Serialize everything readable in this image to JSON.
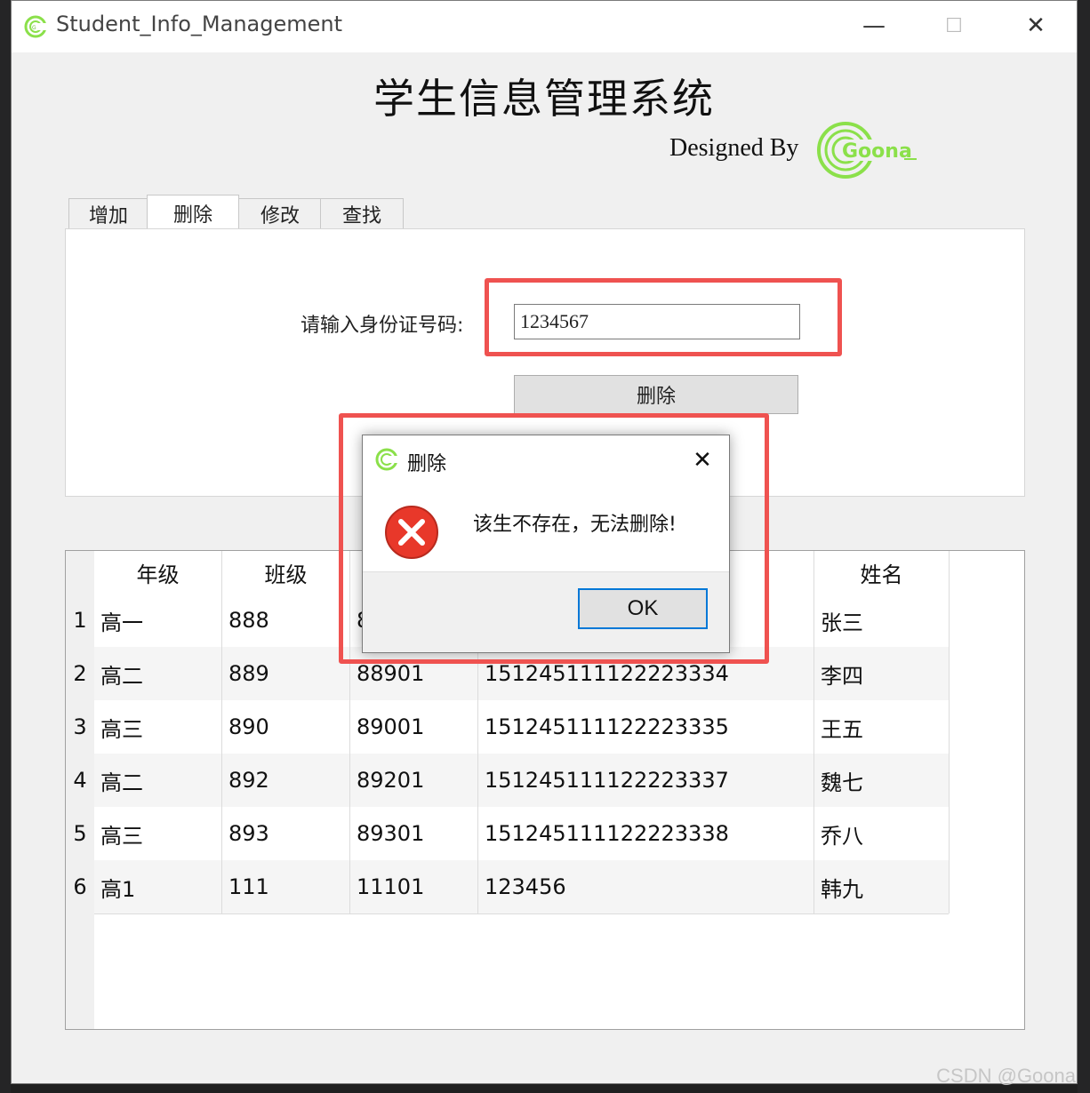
{
  "window": {
    "title": "Student_Info_Management",
    "minimize_glyph": "—",
    "maximize_glyph": "☐",
    "close_glyph": "✕"
  },
  "header": {
    "main_title": "学生信息管理系统",
    "designed_by": "Designed By",
    "logo_text": "Goona"
  },
  "tabs": [
    {
      "label": "增加"
    },
    {
      "label": "删除"
    },
    {
      "label": "修改"
    },
    {
      "label": "查找"
    }
  ],
  "delete_panel": {
    "id_label": "请输入身份证号码:",
    "id_value": "1234567",
    "delete_button": "删除"
  },
  "table": {
    "columns": [
      "年级",
      "班级",
      "",
      "",
      "姓名"
    ],
    "rows": [
      {
        "num": "1",
        "cells": [
          "高一",
          "888",
          "8",
          "",
          "张三"
        ]
      },
      {
        "num": "2",
        "cells": [
          "高二",
          "889",
          "88901",
          "151245111122223334",
          "李四"
        ]
      },
      {
        "num": "3",
        "cells": [
          "高三",
          "890",
          "89001",
          "151245111122223335",
          "王五"
        ]
      },
      {
        "num": "4",
        "cells": [
          "高二",
          "892",
          "89201",
          "151245111122223337",
          "魏七"
        ]
      },
      {
        "num": "5",
        "cells": [
          "高三",
          "893",
          "89301",
          "151245111122223338",
          "乔八"
        ]
      },
      {
        "num": "6",
        "cells": [
          "高1",
          "111",
          "11101",
          "123456",
          "韩九"
        ]
      }
    ]
  },
  "dialog": {
    "title": "删除",
    "message": "该生不存在，无法删除!",
    "ok_label": "OK",
    "close_glyph": "✕"
  },
  "watermark": "CSDN @Goona",
  "colors": {
    "accent_green": "#8be04a",
    "highlight_red": "#ef5250",
    "error_red": "#e8382a",
    "focus_blue": "#0078d7"
  }
}
